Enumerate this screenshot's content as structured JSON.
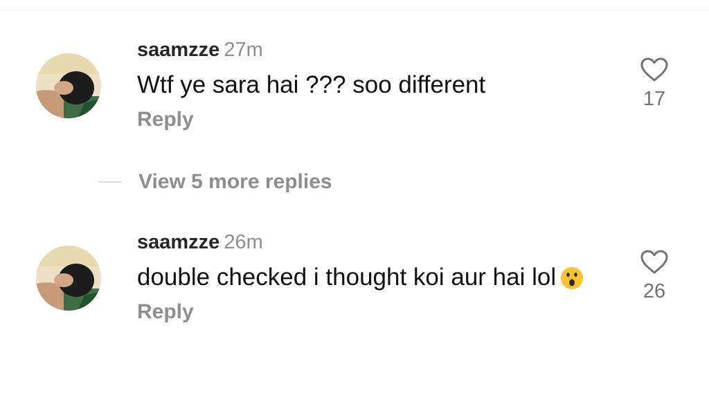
{
  "comments": [
    {
      "username": "saamzze",
      "time": "27m",
      "text": "Wtf ye sara hai ??? soo different",
      "reply_label": "Reply",
      "like_count": "17"
    },
    {
      "username": "saamzze",
      "time": "26m",
      "text": "double checked i thought koi aur hai lol",
      "emoji": "astonished-face",
      "reply_label": "Reply",
      "like_count": "26"
    }
  ],
  "view_more": {
    "label": "View 5 more replies"
  },
  "colors": {
    "muted": "#8e8e8e",
    "username": "#262626",
    "line": "#dbdbdb"
  }
}
